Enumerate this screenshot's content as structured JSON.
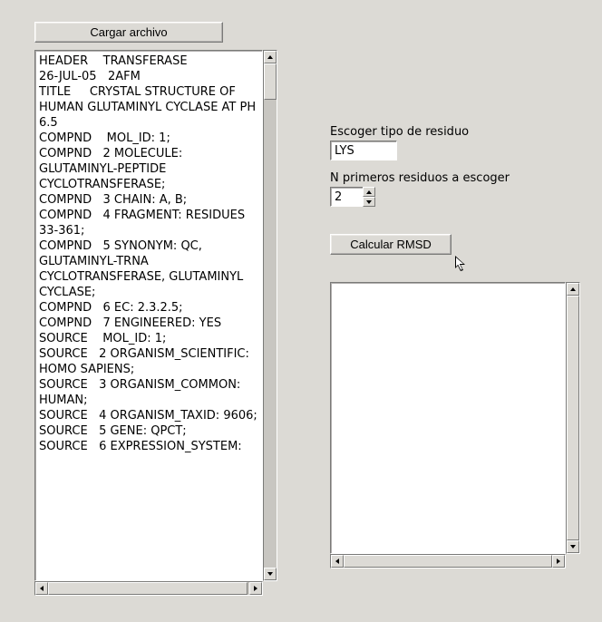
{
  "buttons": {
    "load_file": "Cargar archivo",
    "calculate": "Calcular RMSD"
  },
  "labels": {
    "residue_type": "Escoger tipo de residuo",
    "n_first": "N primeros residuos a escoger"
  },
  "inputs": {
    "residue_type_value": "LYS",
    "n_first_value": "2"
  },
  "file_content": "HEADER    TRANSFERASE                             26-JUL-05   2AFM\nTITLE     CRYSTAL STRUCTURE OF HUMAN GLUTAMINYL CYCLASE AT PH 6.5\nCOMPND    MOL_ID: 1;\nCOMPND   2 MOLECULE: GLUTAMINYL-PEPTIDE CYCLOTRANSFERASE;\nCOMPND   3 CHAIN: A, B;\nCOMPND   4 FRAGMENT: RESIDUES 33-361;\nCOMPND   5 SYNONYM: QC, GLUTAMINYL-TRNA CYCLOTRANSFERASE, GLUTAMINYL CYCLASE;\nCOMPND   6 EC: 2.3.2.5;\nCOMPND   7 ENGINEERED: YES\nSOURCE    MOL_ID: 1;\nSOURCE   2 ORGANISM_SCIENTIFIC: HOMO SAPIENS;\nSOURCE   3 ORGANISM_COMMON: HUMAN;\nSOURCE   4 ORGANISM_TAXID: 9606;\nSOURCE   5 GENE: QPCT;\nSOURCE   6 EXPRESSION_SYSTEM:",
  "result_content": ""
}
